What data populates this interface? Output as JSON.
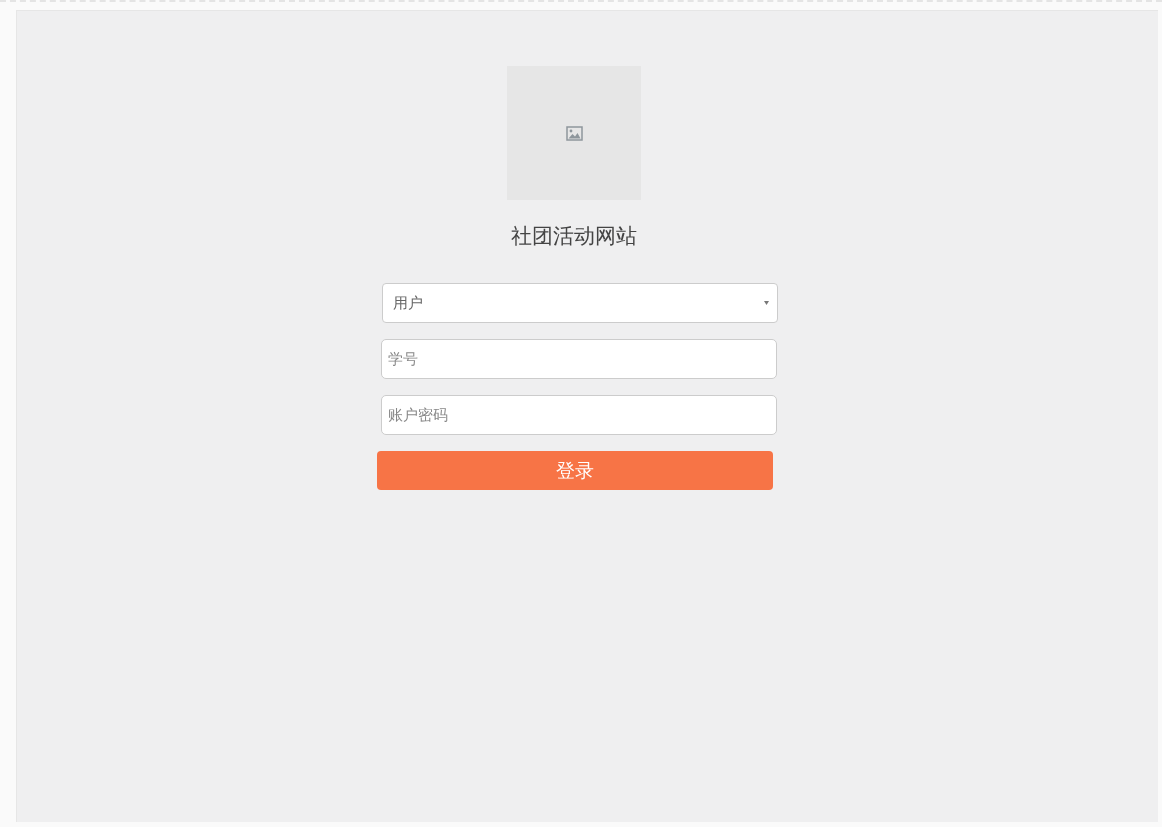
{
  "site_title": "社团活动网站",
  "form": {
    "role_select": {
      "value": "用户"
    },
    "student_id_field": {
      "placeholder": "学号"
    },
    "password_field": {
      "placeholder": "账户密码"
    },
    "submit": {
      "label": "登录"
    }
  }
}
